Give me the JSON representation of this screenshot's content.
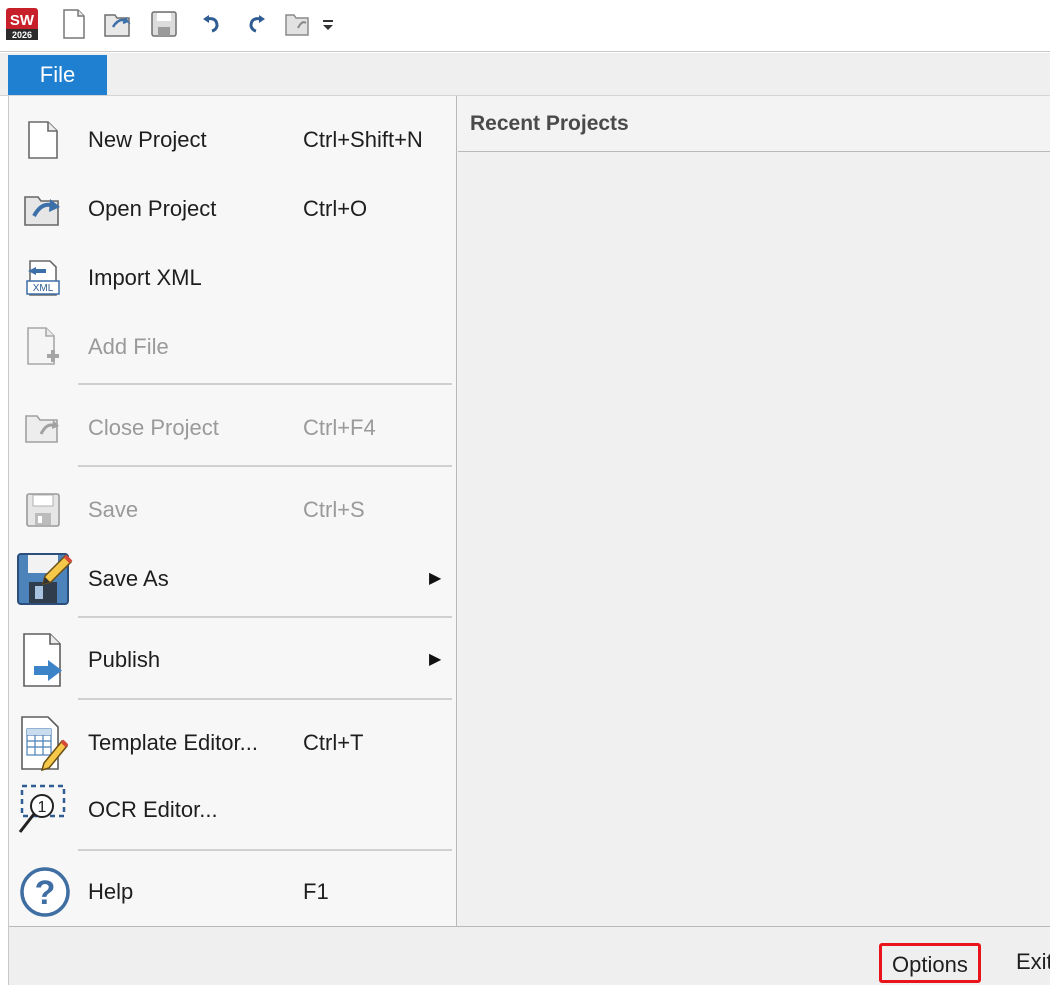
{
  "quick_access": {
    "icons": [
      "app-logo-icon",
      "new-icon",
      "open-icon",
      "save-icon",
      "undo-icon",
      "redo-icon",
      "close-project-icon",
      "customize-dropdown-icon"
    ],
    "app_logo_text": "SW",
    "app_logo_year": "2026"
  },
  "tabs": {
    "file": "File"
  },
  "menu": {
    "items": [
      {
        "label": "New Project",
        "shortcut": "Ctrl+Shift+N",
        "icon": "new-document-icon",
        "enabled": true
      },
      {
        "label": "Open Project",
        "shortcut": "Ctrl+O",
        "icon": "open-project-icon",
        "enabled": true
      },
      {
        "label": "Import XML",
        "shortcut": "",
        "icon": "import-xml-icon",
        "enabled": true
      },
      {
        "label": "Add File",
        "shortcut": "",
        "icon": "add-file-icon",
        "enabled": false
      },
      {
        "label": "Close Project",
        "shortcut": "Ctrl+F4",
        "icon": "close-project-icon",
        "enabled": false
      },
      {
        "label": "Save",
        "shortcut": "Ctrl+S",
        "icon": "save-icon",
        "enabled": false
      },
      {
        "label": "Save As",
        "shortcut": "",
        "icon": "save-as-icon",
        "enabled": true,
        "submenu": true
      },
      {
        "label": "Publish",
        "shortcut": "",
        "icon": "publish-icon",
        "enabled": true,
        "submenu": true
      },
      {
        "label": "Template Editor...",
        "shortcut": "Ctrl+T",
        "icon": "template-editor-icon",
        "enabled": true
      },
      {
        "label": "OCR Editor...",
        "shortcut": "",
        "icon": "ocr-editor-icon",
        "enabled": true
      },
      {
        "label": "Help",
        "shortcut": "F1",
        "icon": "help-icon",
        "enabled": true
      }
    ],
    "xml_badge": "XML",
    "ocr_badge": "1",
    "help_glyph": "?"
  },
  "recent": {
    "title": "Recent Projects"
  },
  "bottom": {
    "options_label": "Options",
    "exit_label": "Exit"
  },
  "colors": {
    "accent": "#1f7fd1",
    "highlight_box": "#e8131b",
    "app_logo_red": "#c8202a"
  }
}
